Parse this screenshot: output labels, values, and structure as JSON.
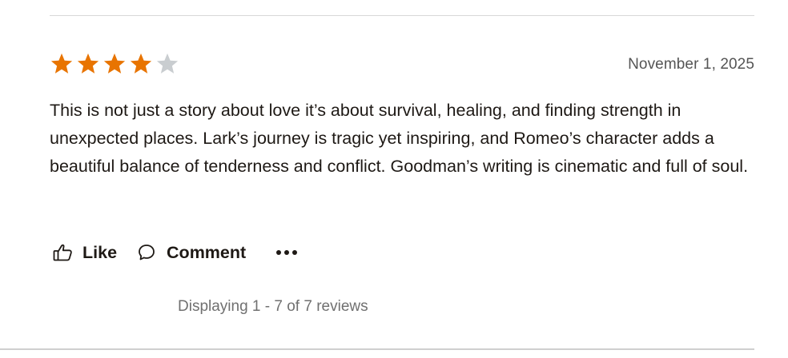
{
  "review": {
    "rating": 4,
    "max_rating": 5,
    "date": "November 1, 2025",
    "text": "This is not just a story about love it’s about survival, healing, and finding strength in unexpected places. Lark’s journey is tragic yet inspiring, and Romeo’s character adds a beautiful balance of tenderness and conflict. Goodman’s writing is cinematic and full of soul."
  },
  "actions": {
    "like_label": "Like",
    "comment_label": "Comment",
    "like_icon": "thumbs-up-icon",
    "comment_icon": "speech-bubble-icon",
    "more_icon": "more-options-icon"
  },
  "footer": {
    "pagination_text": "Displaying 1 - 7 of 7 reviews"
  },
  "colors": {
    "star_filled": "#e87400",
    "star_empty": "#c9cdd0",
    "text": "#1e1915",
    "muted": "#555555"
  }
}
